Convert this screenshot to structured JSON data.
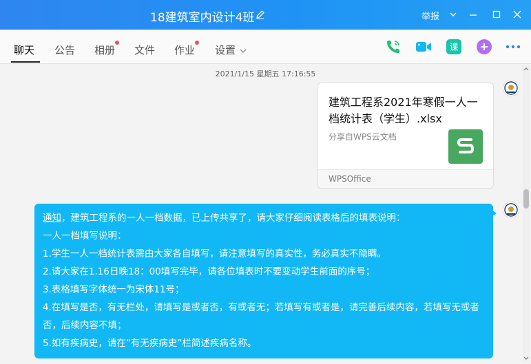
{
  "window": {
    "title": "18建筑室内设计4班",
    "report_label": "举报"
  },
  "tabs": [
    {
      "label": "聊天",
      "active": true,
      "badge": false
    },
    {
      "label": "公告",
      "active": false,
      "badge": false
    },
    {
      "label": "相册",
      "active": false,
      "badge": true
    },
    {
      "label": "文件",
      "active": false,
      "badge": false
    },
    {
      "label": "作业",
      "active": false,
      "badge": true
    },
    {
      "label": "设置",
      "active": false,
      "badge": false
    }
  ],
  "toolbar_icons": [
    "phone-icon",
    "video-icon",
    "course-icon",
    "add-app-icon",
    "more-icon"
  ],
  "chat": {
    "timestamp": "2021/1/15 星期五 17:16:55",
    "file_card": {
      "name": "建筑工程系2021年寒假一人一档统计表（学生）.xlsx",
      "source": "分享自WPS云文档",
      "app": "WPSOffice",
      "logo_color": "#48a860"
    },
    "message": {
      "link": "通知",
      "lines": [
        "，建筑工程系的一人一档数据，已上传共享了，请大家仔细阅读表格后的填表说明：",
        "一人一档填写说明：",
        "1.学生一人一档统计表需由大家各自填写，请注意填写的真实性，务必真实不隐瞒。",
        "2.请大家在1.16日晚18：00填写完毕，请各位填表时不要变动学生前面的序号；",
        "3.表格填写字体统一为宋体11号；",
        "4.在填写是否，有无栏处，请填写是或者否，有或者无；若填写有或者是，请完善后续内容，若填写无或者否，后续内容不填；",
        "5.如有疾病史，请在“有无疾病史”栏简述疾病名称。"
      ]
    }
  },
  "colors": {
    "titlebar": "#2f86f0",
    "bubble": "#12b7f5",
    "badge": "#f05050"
  }
}
